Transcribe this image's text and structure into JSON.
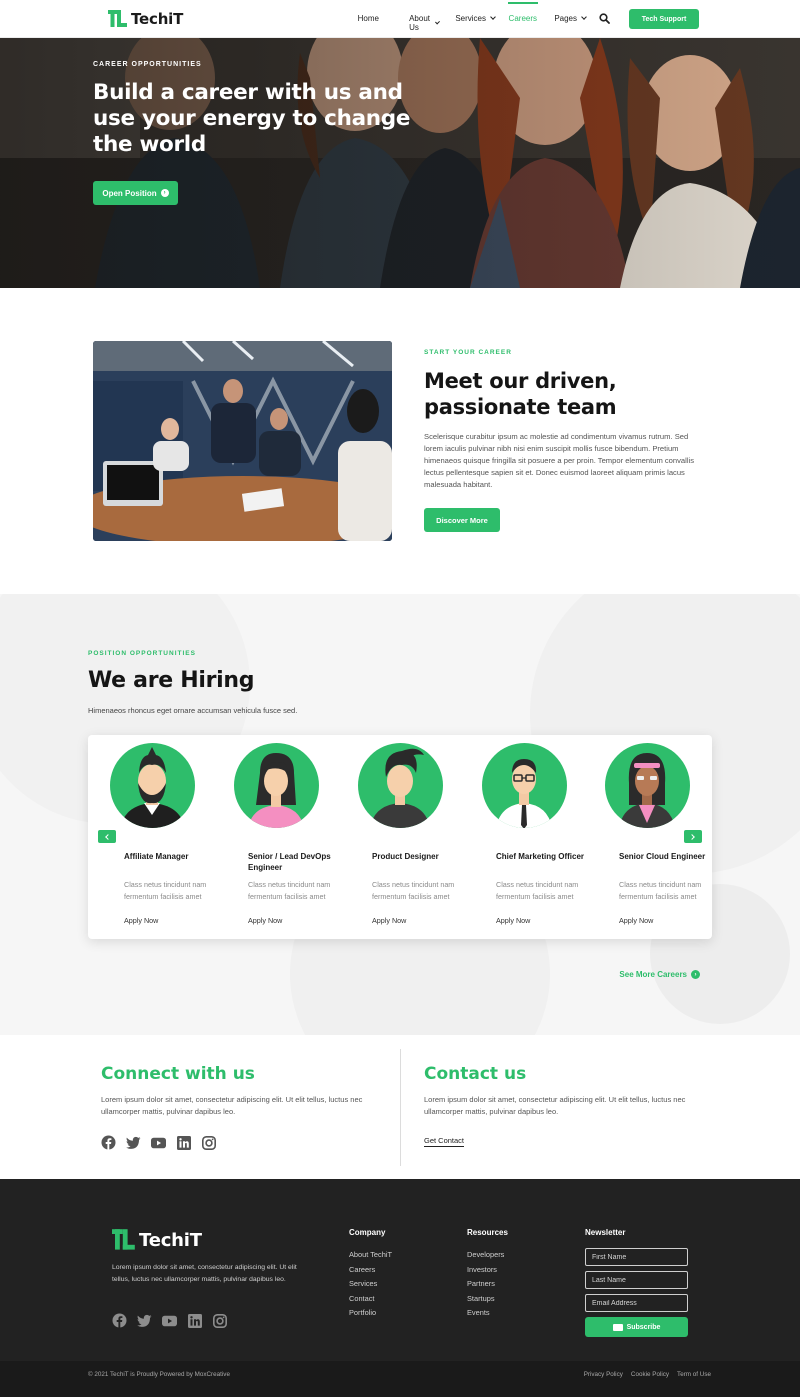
{
  "brand": {
    "name": "TechiT",
    "accent": "#2ebd6b"
  },
  "nav": {
    "items": [
      {
        "label": "Home"
      },
      {
        "label": "About Us",
        "dropdown": true
      },
      {
        "label": "Services",
        "dropdown": true
      },
      {
        "label": "Careers",
        "active": true
      },
      {
        "label": "Pages",
        "dropdown": true
      }
    ],
    "search_icon": "search-icon",
    "cta": "Tech Support"
  },
  "hero": {
    "kicker": "CAREER OPPORTUNITIES",
    "title": "Build a career with us and use your energy to change the world",
    "button": "Open Position"
  },
  "team": {
    "kicker": "START YOUR CAREER",
    "title": "Meet our driven, passionate team",
    "body": "Scelerisque curabitur ipsum ac molestie ad condimentum vivamus rutrum. Sed lorem iaculis pulvinar nibh nisi enim suscipit mollis fusce bibendum. Pretium himenaeos quisque fringilla sit posuere a per proin. Tempor elementum convallis lectus pellentesque sapien sit et. Donec euismod laoreet aliquam primis lacus malesuada habitant.",
    "button": "Discover More"
  },
  "hiring": {
    "kicker": "POSITION OPPORTUNITIES",
    "title": "We are Hiring",
    "subtitle": "Himenaeos rhoncus eget ornare accumsan vehicula fusce sed.",
    "positions": [
      {
        "title": "Affiliate Manager",
        "desc": "Class netus tincidunt nam fermentum facilisis amet",
        "apply": "Apply Now"
      },
      {
        "title": "Senior / Lead DevOps Engineer",
        "desc": "Class netus tincidunt nam fermentum facilisis amet",
        "apply": "Apply Now"
      },
      {
        "title": "Product Designer",
        "desc": "Class netus tincidunt nam fermentum facilisis amet",
        "apply": "Apply Now"
      },
      {
        "title": "Chief Marketing Officer",
        "desc": "Class netus tincidunt nam fermentum facilisis amet",
        "apply": "Apply Now"
      },
      {
        "title": "Senior Cloud Engineer",
        "desc": "Class netus tincidunt nam fermentum facilisis amet",
        "apply": "Apply Now"
      }
    ],
    "see_more": "See More Careers"
  },
  "connect": {
    "title": "Connect with us",
    "body": "Lorem ipsum dolor sit amet, consectetur adipiscing elit. Ut elit tellus, luctus nec ullamcorper mattis, pulvinar dapibus leo.",
    "social": [
      "facebook-icon",
      "twitter-icon",
      "youtube-icon",
      "linkedin-icon",
      "instagram-icon"
    ]
  },
  "contact": {
    "title": "Contact us",
    "body": "Lorem ipsum dolor sit amet, consectetur adipiscing elit. Ut elit tellus, luctus nec ullamcorper mattis, pulvinar dapibus leo.",
    "link": "Get Contact"
  },
  "footer": {
    "about": "Lorem ipsum dolor sit amet, consectetur adipiscing elit. Ut elit tellus, luctus nec ullamcorper mattis, pulvinar dapibus leo.",
    "company": {
      "title": "Company",
      "links": [
        "About TechiT",
        "Careers",
        "Services",
        "Contact",
        "Portfolio"
      ]
    },
    "resources": {
      "title": "Resources",
      "links": [
        "Developers",
        "Investors",
        "Partners",
        "Startups",
        "Events"
      ]
    },
    "newsletter": {
      "title": "Newsletter",
      "first_name": "First Name",
      "last_name": "Last Name",
      "email": "Email Address",
      "button": "Subscribe"
    },
    "copyright": "© 2021 TechiT is Proudly Powered by MoxCreative",
    "legal": [
      "Privacy Policy",
      "Cookie Policy",
      "Term of Use"
    ]
  }
}
